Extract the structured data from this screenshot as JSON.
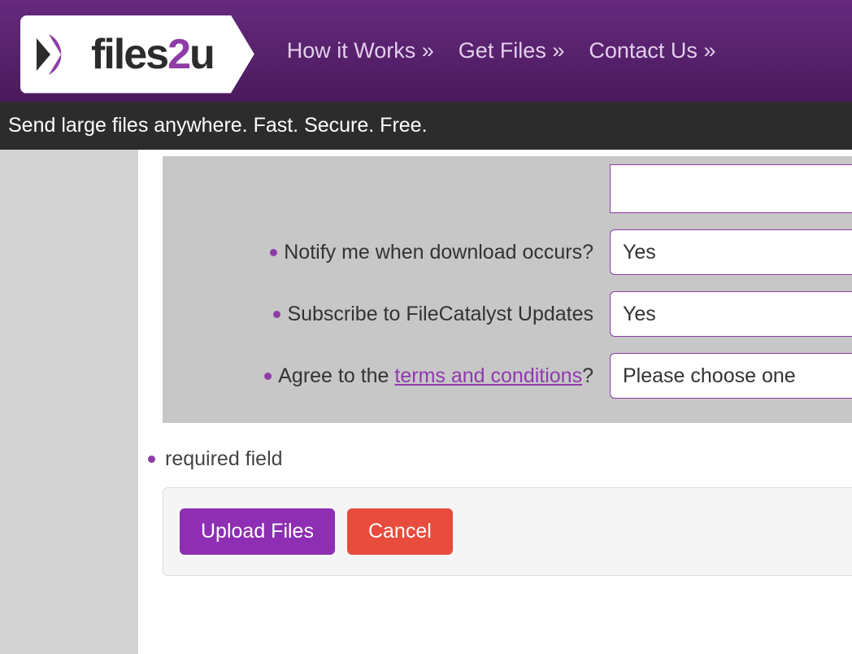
{
  "nav": {
    "items": [
      {
        "label": "How it Works »"
      },
      {
        "label": "Get Files »"
      },
      {
        "label": "Contact Us »"
      }
    ]
  },
  "tagline": "Send large files anywhere. Fast. Secure. Free.",
  "form": {
    "notify": {
      "label": "Notify me when download occurs?",
      "value": "Yes"
    },
    "subscribe": {
      "label": "Subscribe to FileCatalyst Updates",
      "value": "Yes"
    },
    "agree": {
      "prefix": "Agree to the ",
      "link": "terms and conditions",
      "suffix": "?",
      "value": "Please choose one"
    }
  },
  "legend": "required field",
  "buttons": {
    "upload": "Upload Files",
    "cancel": "Cancel"
  }
}
